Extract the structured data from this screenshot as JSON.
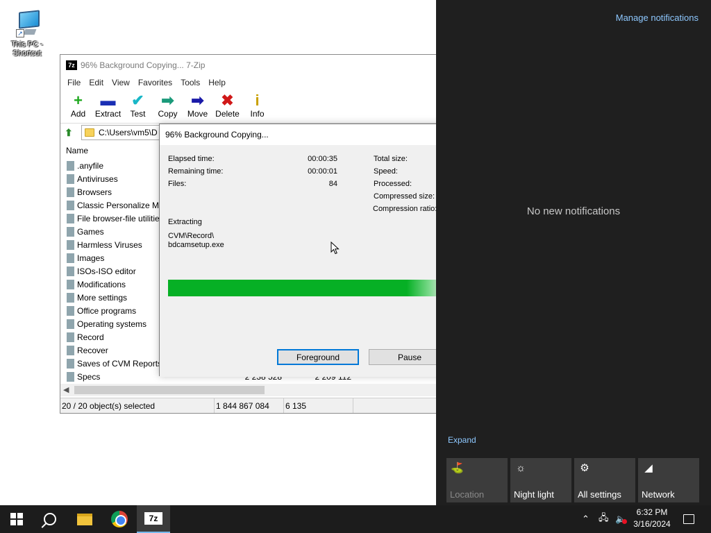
{
  "desktop": {
    "shortcut_label": "This PC - Shortcut"
  },
  "zip_window": {
    "title": "96% Background Copying... 7-Zip",
    "app_icon": "7z",
    "menu": [
      "File",
      "Edit",
      "View",
      "Favorites",
      "Tools",
      "Help"
    ],
    "toolbar": [
      {
        "label": "Add",
        "icon": "plus-icon",
        "glyph": "+",
        "color": "#1fa81f"
      },
      {
        "label": "Extract",
        "icon": "minus-icon",
        "glyph": "▬",
        "color": "#1a2fb4"
      },
      {
        "label": "Test",
        "icon": "check-icon",
        "glyph": "✔",
        "color": "#19b7c7"
      },
      {
        "label": "Copy",
        "icon": "copy-arrow-icon",
        "glyph": "➡",
        "color": "#1b9a7a"
      },
      {
        "label": "Move",
        "icon": "move-arrow-icon",
        "glyph": "➡",
        "color": "#1a1aa8"
      },
      {
        "label": "Delete",
        "icon": "delete-x-icon",
        "glyph": "✖",
        "color": "#d01818"
      },
      {
        "label": "Info",
        "icon": "info-icon",
        "glyph": "i",
        "color": "#c9a000"
      }
    ],
    "address_path": "C:\\Users\\vm5\\D",
    "list_header": "Name",
    "rows": [
      {
        "name": ".anyfile",
        "size": "",
        "packed": ""
      },
      {
        "name": "Antiviruses",
        "size": "",
        "packed": ""
      },
      {
        "name": "Browsers",
        "size": "",
        "packed": ""
      },
      {
        "name": "Classic Personalize Me",
        "size": "",
        "packed": ""
      },
      {
        "name": "File browser-file utilitie",
        "size": "",
        "packed": ""
      },
      {
        "name": "Games",
        "size": "",
        "packed": ""
      },
      {
        "name": "Harmless Viruses",
        "size": "",
        "packed": ""
      },
      {
        "name": "Images",
        "size": "",
        "packed": ""
      },
      {
        "name": "ISOs-ISO editor",
        "size": "",
        "packed": ""
      },
      {
        "name": "Modifications",
        "size": "",
        "packed": ""
      },
      {
        "name": "More settings",
        "size": "",
        "packed": ""
      },
      {
        "name": "Office programs",
        "size": "",
        "packed": ""
      },
      {
        "name": "Operating systems",
        "size": "",
        "packed": ""
      },
      {
        "name": "Record",
        "size": "",
        "packed": ""
      },
      {
        "name": "Recover",
        "size": "",
        "packed": ""
      },
      {
        "name": "Saves of CVM Reports I",
        "size": "",
        "packed": ""
      },
      {
        "name": "Specs",
        "size": "2 238 528",
        "packed": "2 209 112"
      }
    ],
    "status": {
      "selected": "20 / 20 object(s) selected",
      "total_size": "1 844 867 084",
      "count": "6 135"
    }
  },
  "progress_dialog": {
    "title": "96% Background Copying...",
    "elapsed_label": "Elapsed time:",
    "elapsed_value": "00:00:35",
    "remaining_label": "Remaining time:",
    "remaining_value": "00:00:01",
    "files_label": "Files:",
    "files_value": "84",
    "total_size_label": "Total size:",
    "speed_label": "Speed:",
    "processed_label": "Processed:",
    "compressed_label": "Compressed size:",
    "ratio_label": "Compression ratio:",
    "operation": "Extracting",
    "current_path": "CVM\\Record\\",
    "current_file": "bdcamsetup.exe",
    "progress_percent": 96,
    "foreground_button": "Foreground",
    "pause_button": "Pause"
  },
  "action_center": {
    "manage_link": "Manage notifications",
    "empty_text": "No new notifications",
    "expand_link": "Expand",
    "tiles": [
      {
        "label": "Location",
        "icon": "location-icon",
        "glyph": "⛳",
        "enabled": false
      },
      {
        "label": "Night light",
        "icon": "night-light-icon",
        "glyph": "☼",
        "enabled": true
      },
      {
        "label": "All settings",
        "icon": "gear-icon",
        "glyph": "⚙",
        "enabled": true
      },
      {
        "label": "Network",
        "icon": "network-icon",
        "glyph": "◢",
        "enabled": true
      }
    ]
  },
  "taskbar": {
    "time": "6:32 PM",
    "date": "3/16/2024",
    "tray_chevron": "⌃",
    "tray_network": "🖧",
    "tray_volume": "🔈"
  },
  "colors": {
    "progress_green": "#06b025",
    "action_center_bg": "#1f1f1f",
    "taskbar_bg": "#1c1c1c",
    "link_blue": "#8ec8ff"
  }
}
